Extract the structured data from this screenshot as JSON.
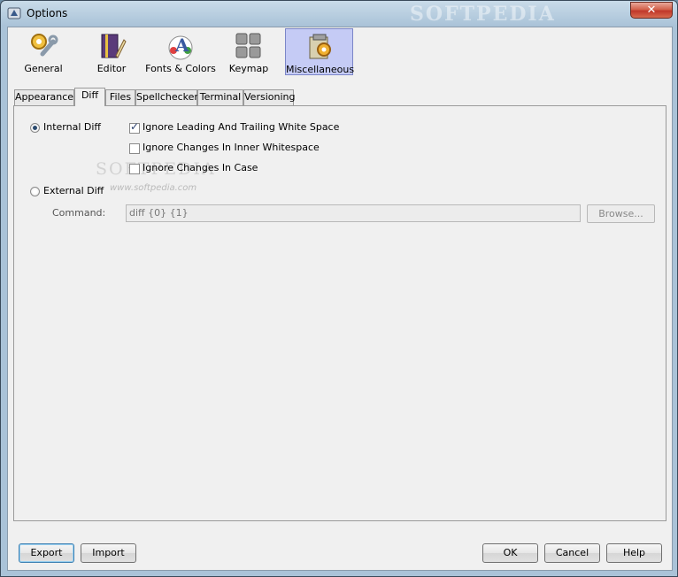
{
  "window": {
    "title": "Options",
    "watermark": "SOFTPEDIA",
    "close_label": "✕"
  },
  "toolbar": {
    "items": [
      {
        "label": "General",
        "icon": "gear-wrench-icon"
      },
      {
        "label": "Editor",
        "icon": "book-pen-icon"
      },
      {
        "label": "Fonts & Colors",
        "icon": "font-palette-icon"
      },
      {
        "label": "Keymap",
        "icon": "keyboard-icon"
      },
      {
        "label": "Miscellaneous",
        "icon": "misc-gear-icon",
        "selected": true
      }
    ]
  },
  "tabs": [
    {
      "label": "Appearance"
    },
    {
      "label": "Diff",
      "selected": true
    },
    {
      "label": "Files"
    },
    {
      "label": "Spellchecker"
    },
    {
      "label": "Terminal"
    },
    {
      "label": "Versioning"
    }
  ],
  "diff": {
    "internal_label": "Internal Diff",
    "internal_selected": true,
    "options": [
      {
        "label": "Ignore Leading And Trailing White Space",
        "checked": true
      },
      {
        "label": "Ignore Changes In Inner Whitespace",
        "checked": false
      },
      {
        "label": "Ignore Changes In Case",
        "checked": false
      }
    ],
    "external_label": "External Diff",
    "external_selected": false,
    "command_label": "Command:",
    "command_value": "diff {0} {1}",
    "browse_label": "Browse...",
    "watermark_big": "SOFTPEDIA",
    "watermark_small": "www.softpedia.com"
  },
  "buttons": {
    "export": "Export",
    "import": "Import",
    "ok": "OK",
    "cancel": "Cancel",
    "help": "Help"
  }
}
